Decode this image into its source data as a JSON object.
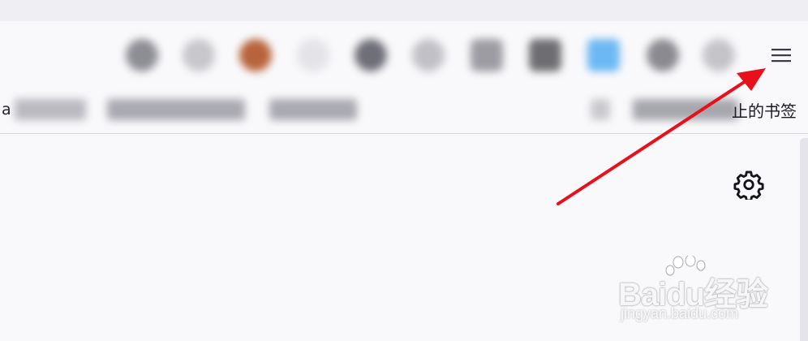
{
  "toolbar": {
    "menu_icon": "hamburger-menu-icon"
  },
  "bookmarks": {
    "truncated_left": "a",
    "other_bookmarks": "止的书签"
  },
  "panel": {
    "gear_icon": "gear-icon"
  },
  "annotation": {
    "color": "#e8101a"
  },
  "watermark": {
    "brand": "Baidu经验",
    "url": "jingyan.baidu.com"
  }
}
